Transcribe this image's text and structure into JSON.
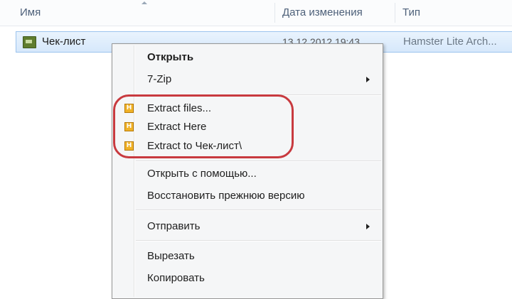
{
  "columns": {
    "name": "Имя",
    "date": "Дата изменения",
    "type": "Тип"
  },
  "file": {
    "name": "Чек-лист",
    "date": "13.12.2012 19:43",
    "type": "Hamster Lite Arch..."
  },
  "menu": {
    "open": "Открыть",
    "seven_zip": "7-Zip",
    "extract_files": "Extract files...",
    "extract_here": "Extract Here",
    "extract_to": "Extract to Чек-лист\\",
    "open_with": "Открыть с помощью...",
    "restore_version": "Восстановить прежнюю версию",
    "send_to": "Отправить",
    "cut": "Вырезать",
    "copy": "Копировать"
  },
  "icons": {
    "hamster_glyph": "H",
    "hamster_color": "#f0b227",
    "highlight_color": "#c83a3f"
  }
}
